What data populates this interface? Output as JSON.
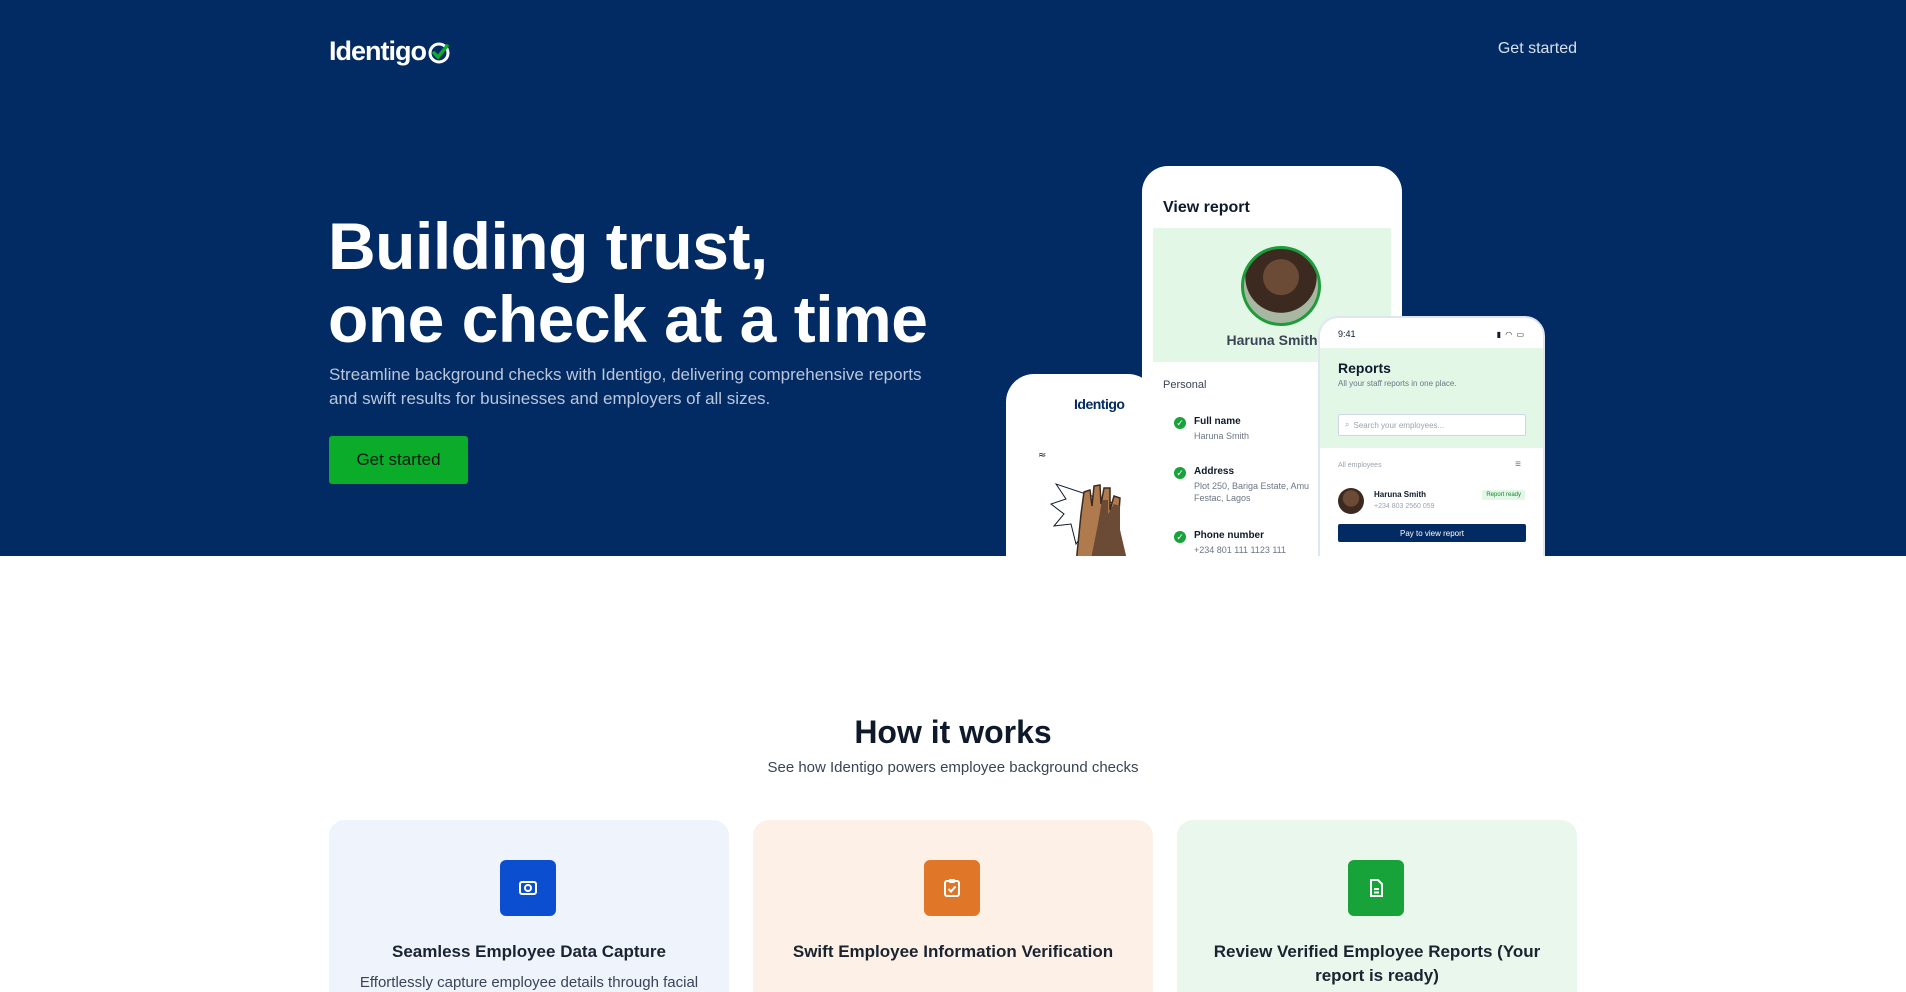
{
  "header": {
    "logo_text": "Identigo",
    "nav_cta": "Get started"
  },
  "hero": {
    "title_line1": "Building trust,",
    "title_line2": "one check at a time",
    "subtitle": "Streamline background checks with Identigo, delivering comprehensive reports and swift results for businesses and employers of all sizes.",
    "cta": "Get started"
  },
  "mockups": {
    "phone_a": {
      "logo": "Identigo"
    },
    "phone_b": {
      "title": "View report",
      "name": "Haruna Smith",
      "section": "Personal",
      "items": [
        {
          "label": "Full name",
          "value": "Haruna Smith"
        },
        {
          "label": "Address",
          "value": "Plot 250, Bariga Estate, Amu Festac, Lagos"
        },
        {
          "label": "Phone number",
          "value": "+234 801 111 1123 111"
        }
      ]
    },
    "phone_c": {
      "time": "9:41",
      "title": "Reports",
      "subtitle": "All your staff reports in one place.",
      "search_placeholder": "Search your employees...",
      "filter_label": "All employees",
      "row": {
        "name": "Haruna Smith",
        "phone": "+234 803 2560 059",
        "badge": "Report ready"
      },
      "button": "Pay to view report"
    }
  },
  "how_it_works": {
    "title": "How it works",
    "subtitle": "See how Identigo powers employee background checks",
    "cards": [
      {
        "icon": "camera-icon",
        "title": "Seamless Employee Data Capture",
        "description": "Effortlessly capture employee details through facial"
      },
      {
        "icon": "clipboard-check-icon",
        "title": "Swift Employee Information Verification",
        "description": ""
      },
      {
        "icon": "document-icon",
        "title": "Review Verified Employee Reports (Your report is ready)",
        "description": ""
      }
    ]
  },
  "colors": {
    "hero_bg": "#022b63",
    "brand_green": "#0aac2a",
    "card1_bg": "#eef3fc",
    "card2_bg": "#fdf1e7",
    "card3_bg": "#eaf7ed"
  }
}
